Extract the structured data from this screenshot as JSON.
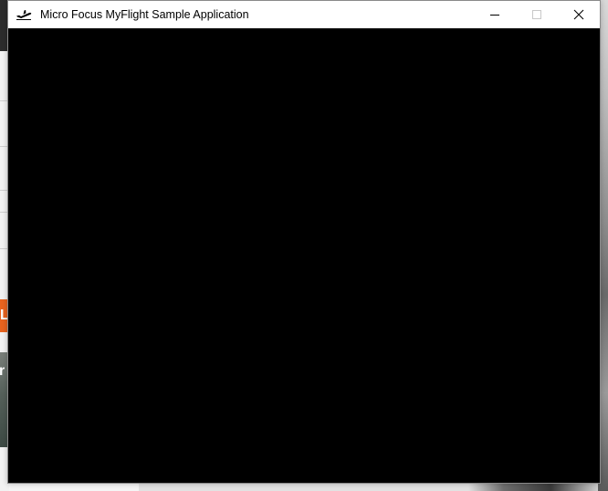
{
  "window": {
    "title": "Micro Focus MyFlight Sample Application",
    "app_icon": "airplane-takeoff-icon",
    "controls": {
      "minimize_icon": "minimize-icon",
      "maximize_icon": "maximize-icon",
      "close_icon": "close-icon",
      "maximize_enabled": false
    },
    "content_color": "#000000"
  },
  "background": {
    "orange_tab_text": "L",
    "photo_text": "r",
    "accent_color": "#e8641f"
  }
}
